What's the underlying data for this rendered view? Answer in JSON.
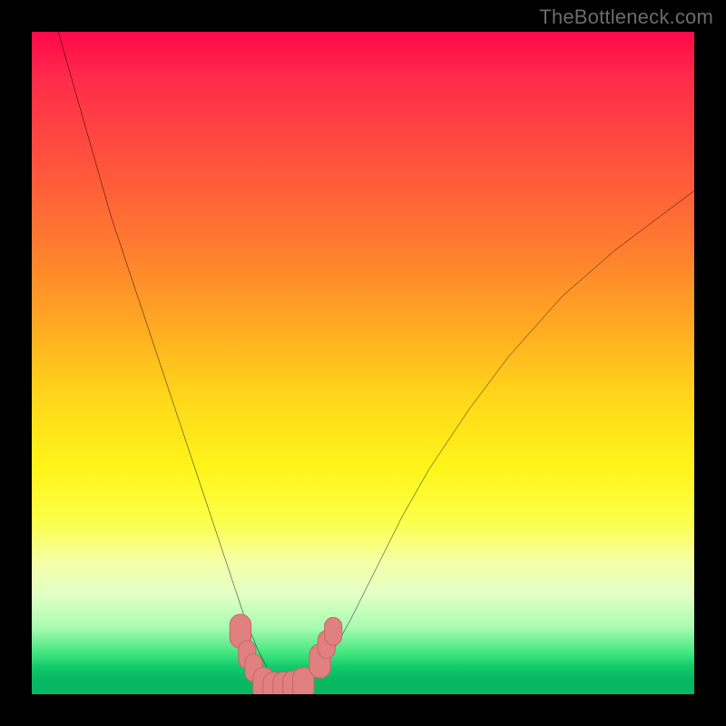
{
  "watermark": "TheBottleneck.com",
  "colors": {
    "curve": "#000000",
    "marker_fill": "#e08080",
    "marker_stroke": "#cc6868",
    "frame": "#000000"
  },
  "chart_data": {
    "type": "line",
    "title": "",
    "xlabel": "",
    "ylabel": "",
    "xlim": [
      0,
      100
    ],
    "ylim": [
      0,
      100
    ],
    "x": [
      4,
      8,
      12,
      16,
      20,
      24,
      28,
      30,
      32,
      34,
      36,
      38,
      40,
      44,
      48,
      52,
      56,
      60,
      66,
      72,
      80,
      88,
      96,
      100
    ],
    "y": [
      100,
      86,
      72,
      60,
      48,
      36,
      24,
      18,
      12,
      7,
      3,
      1,
      1,
      4,
      11,
      19,
      27,
      34,
      43,
      51,
      60,
      67,
      73,
      76
    ],
    "series": [
      {
        "name": "bottleneck-curve",
        "x": [
          4,
          8,
          12,
          16,
          20,
          24,
          28,
          30,
          32,
          34,
          36,
          38,
          40,
          44,
          48,
          52,
          56,
          60,
          66,
          72,
          80,
          88,
          96,
          100
        ],
        "y": [
          100,
          86,
          72,
          60,
          48,
          36,
          24,
          18,
          12,
          7,
          3,
          1,
          1,
          4,
          11,
          19,
          27,
          34,
          43,
          51,
          60,
          67,
          73,
          76
        ]
      }
    ],
    "markers": [
      {
        "x": 31.5,
        "y": 9.5,
        "r": 1.6
      },
      {
        "x": 32.5,
        "y": 6.0,
        "r": 1.3
      },
      {
        "x": 33.5,
        "y": 4.0,
        "r": 1.3
      },
      {
        "x": 35.0,
        "y": 1.5,
        "r": 1.6
      },
      {
        "x": 36.5,
        "y": 0.8,
        "r": 1.6
      },
      {
        "x": 38.0,
        "y": 0.8,
        "r": 1.6
      },
      {
        "x": 39.5,
        "y": 1.0,
        "r": 1.6
      },
      {
        "x": 41.0,
        "y": 1.5,
        "r": 1.6
      },
      {
        "x": 43.5,
        "y": 5.0,
        "r": 1.6
      },
      {
        "x": 44.5,
        "y": 7.5,
        "r": 1.3
      },
      {
        "x": 45.5,
        "y": 9.5,
        "r": 1.3
      }
    ]
  }
}
